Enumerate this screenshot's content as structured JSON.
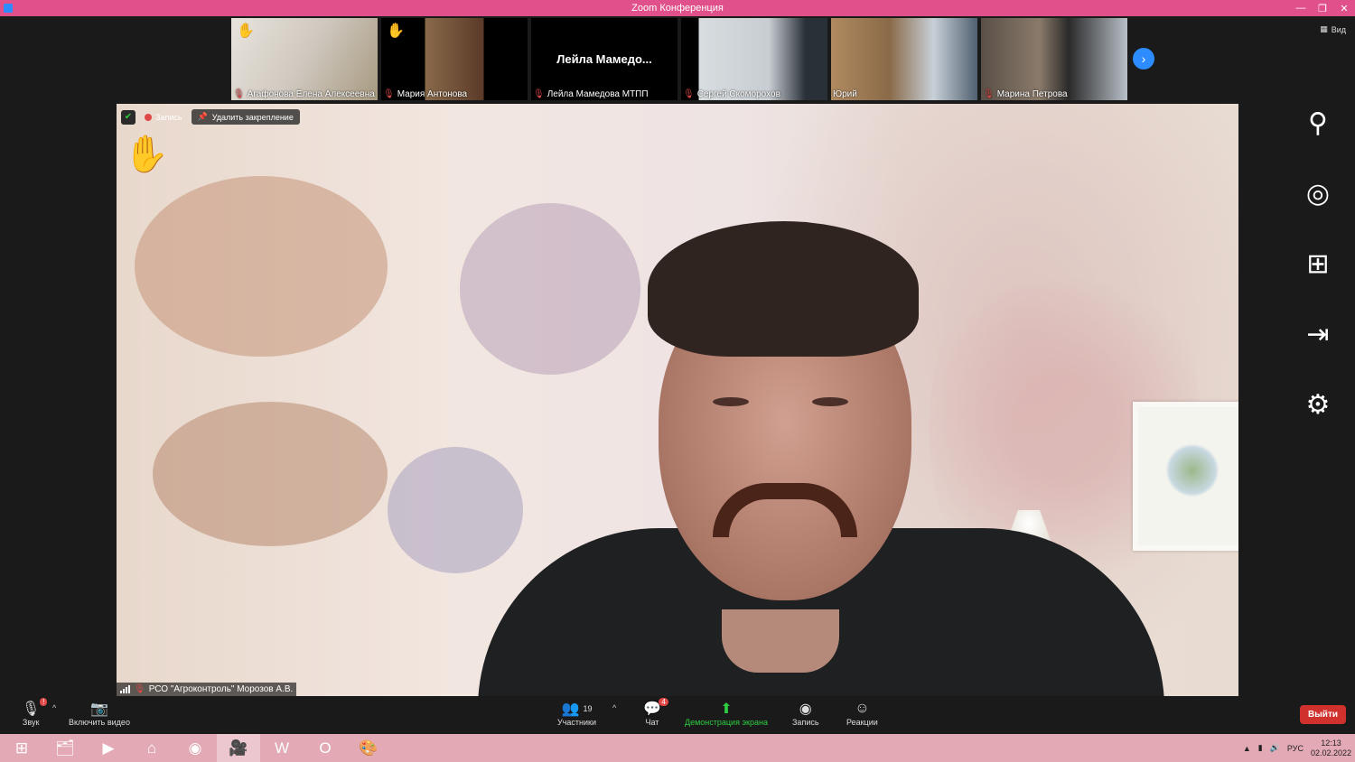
{
  "window": {
    "title": "Zoom Конференция",
    "controls": [
      "—",
      "❐",
      "✕"
    ]
  },
  "strip": {
    "view_label": "Вид",
    "participants": [
      {
        "name": "Агафонова Елена Алексеевна",
        "hand_raised": true,
        "muted": true,
        "bg": "#cfc8bf"
      },
      {
        "name": "Мария Антонова",
        "hand_raised": true,
        "muted": true,
        "bg": "#7a5a3a"
      },
      {
        "name": "Лейла Мамедова МТПП",
        "display": "Лейла  Мамедо...",
        "hand_raised": false,
        "muted": true,
        "bg": "#000000"
      },
      {
        "name": "Сергей Скоморохов",
        "hand_raised": false,
        "muted": true,
        "bg": "#c7cdd2"
      },
      {
        "name": "Юрий",
        "hand_raised": false,
        "muted": false,
        "bg": "#8a6a48"
      },
      {
        "name": "Марина Петрова",
        "hand_raised": false,
        "muted": true,
        "bg": "#6a5a50"
      }
    ]
  },
  "main": {
    "record_label": "Запись",
    "unpin_label": "Удалить закрепление",
    "speaker_name": "РСО \"Агроконтроль\" Морозов А.В."
  },
  "toolbar": {
    "audio_label": "Звук",
    "video_label": "Включить видео",
    "participants_label": "Участники",
    "participants_count": "19",
    "chat_label": "Чат",
    "chat_badge": "4",
    "share_label": "Демонстрация экрана",
    "record_label": "Запись",
    "reactions_label": "Реакции",
    "leave_label": "Выйти",
    "audio_badge": "!"
  },
  "taskbar": {
    "language": "РУС",
    "time": "12:13",
    "date": "02.02.2022"
  },
  "colors": {
    "titlebar": "#e0508a",
    "accent_blue": "#2d8cff",
    "leave_red": "#d0312d",
    "share_green": "#2ecc40",
    "taskbar": "#e3aab5"
  }
}
